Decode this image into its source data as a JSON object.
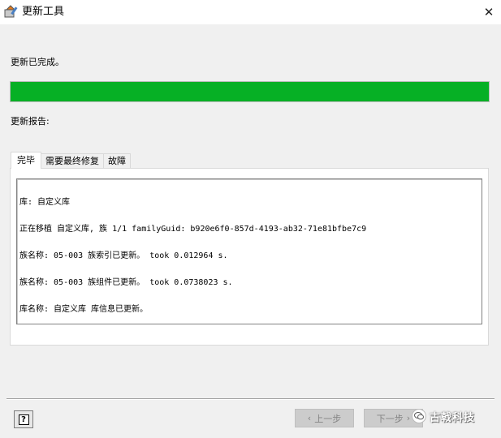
{
  "window": {
    "title": "更新工具",
    "close_glyph": "✕"
  },
  "status": {
    "message": "更新已完成。",
    "progress": 1.0
  },
  "report": {
    "label": "更新报告:"
  },
  "tabs": [
    {
      "label": "完毕",
      "active": true
    },
    {
      "label": "需要最终修复",
      "active": false
    },
    {
      "label": "故障",
      "active": false
    }
  ],
  "log_lines": [
    "库: 自定义库",
    "正在移植 自定义库, 族 1/1 familyGuid: b920e6f0-857d-4193-ab32-71e81bfbe7c9",
    "族名称: 05-003 族索引已更新。 took 0.012964 s.",
    "族名称: 05-003 族组件已更新。 took 0.0738023 s.",
    "库名称: 自定义库 库信息已更新。"
  ],
  "buttons": {
    "help_glyph": "?",
    "prev_label": "上一步",
    "next_label": "下一步",
    "prev_arrow": "‹",
    "next_arrow": "›"
  },
  "watermark": {
    "text": "古戟科技"
  },
  "colors": {
    "progress": "#06b025",
    "window_bg": "#f0f0f0"
  }
}
